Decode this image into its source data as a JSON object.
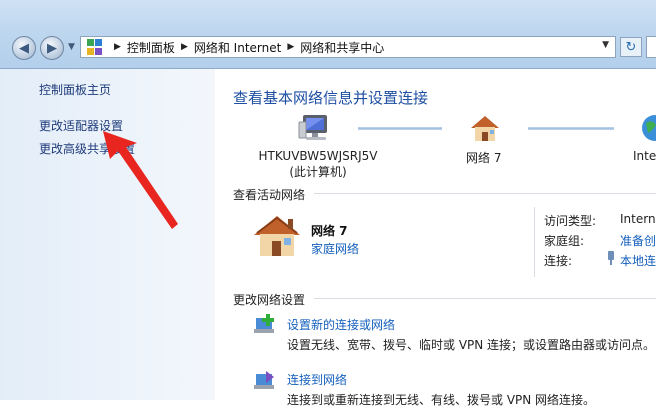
{
  "address_bar": {
    "breadcrumbs": [
      "控制面板",
      "网络和 Internet",
      "网络和共享中心"
    ]
  },
  "sidebar": {
    "items": [
      {
        "label": "控制面板主页"
      },
      {
        "label": "更改适配器设置"
      },
      {
        "label": "更改高级共享设置"
      }
    ]
  },
  "main": {
    "title": "查看基本网络信息并设置连接",
    "map": {
      "computer_name": "HTKUVBW5WJSRJ5V",
      "computer_sub": "(此计算机)",
      "network_name": "网络 7",
      "internet_label": "Inte"
    },
    "active_networks": {
      "title": "查看活动网络",
      "network_name": "网络  7",
      "network_type": "家庭网络",
      "access_type_key": "访问类型:",
      "access_type_val": "Interne",
      "homegroup_key": "家庭组:",
      "homegroup_val": "准备创",
      "connections_key": "连接:",
      "connections_val": "本地连"
    },
    "settings": {
      "title": "更改网络设置",
      "tasks": [
        {
          "title": "设置新的连接或网络",
          "desc": "设置无线、宽带、拨号、临时或 VPN 连接；或设置路由器或访问点。"
        },
        {
          "title": "连接到网络",
          "desc": "连接到或重新连接到无线、有线、拨号或 VPN 网络连接。"
        }
      ]
    }
  },
  "annotation": {
    "arrow_color": "#e8261f"
  }
}
